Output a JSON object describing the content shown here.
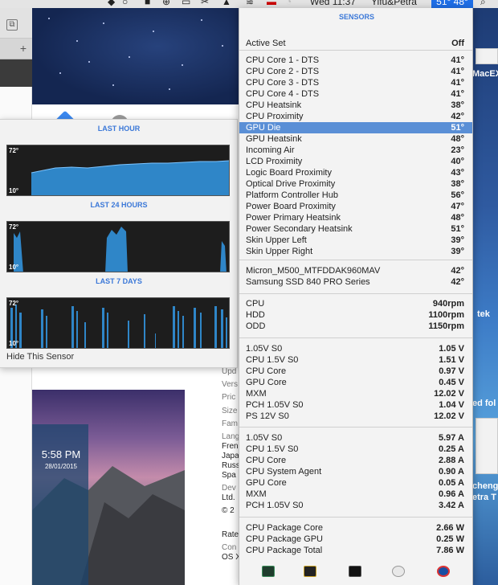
{
  "menubar": {
    "clock": "Wed 11:37",
    "user": "Yifu&Petra",
    "temp_badge": "51° 48°"
  },
  "desktop": {
    "label_top": "MacEX",
    "label_tek": "tek",
    "label_fol": "ed fol",
    "label_cheng": "cheng",
    "label_etra": "etra T"
  },
  "history": {
    "sections": [
      {
        "title": "LAST HOUR",
        "max": "72°",
        "min": "10°"
      },
      {
        "title": "LAST 24 HOURS",
        "max": "72°",
        "min": "10°"
      },
      {
        "title": "LAST 7 DAYS",
        "max": "72°",
        "min": "10°"
      }
    ],
    "hide_label": "Hide This Sensor"
  },
  "bgapp": {
    "labels": [
      "Upd",
      "Vers",
      "Pric",
      "Size",
      "Fam",
      "Lang",
      "Fren",
      "Japa",
      "Russ",
      "Spa",
      "Dev",
      "Ltd.",
      "© 2",
      "Rate",
      "Con",
      "OS X"
    ],
    "lock_time": "5:58 PM",
    "lock_date": "28/01/2015"
  },
  "sensors_menu": {
    "title": "SENSORS",
    "groups": [
      [
        {
          "name": "Active Set",
          "value": "Off"
        }
      ],
      [
        {
          "name": "CPU Core 1 - DTS",
          "value": "41°"
        },
        {
          "name": "CPU Core 2 - DTS",
          "value": "41°"
        },
        {
          "name": "CPU Core 3 - DTS",
          "value": "41°"
        },
        {
          "name": "CPU Core 4 - DTS",
          "value": "41°"
        },
        {
          "name": "CPU Heatsink",
          "value": "38°"
        },
        {
          "name": "CPU Proximity",
          "value": "42°"
        },
        {
          "name": "GPU Die",
          "value": "51°",
          "selected": true
        },
        {
          "name": "GPU Heatsink",
          "value": "48°"
        },
        {
          "name": "Incoming Air",
          "value": "23°"
        },
        {
          "name": "LCD Proximity",
          "value": "40°"
        },
        {
          "name": "Logic Board Proximity",
          "value": "43°"
        },
        {
          "name": "Optical Drive Proximity",
          "value": "38°"
        },
        {
          "name": "Platform Controller Hub",
          "value": "56°"
        },
        {
          "name": "Power Board Proximity",
          "value": "47°"
        },
        {
          "name": "Power Primary Heatsink",
          "value": "48°"
        },
        {
          "name": "Power Secondary Heatsink",
          "value": "51°"
        },
        {
          "name": "Skin Upper Left",
          "value": "39°"
        },
        {
          "name": "Skin Upper Right",
          "value": "39°"
        }
      ],
      [
        {
          "name": "Micron_M500_MTFDDAK960MAV",
          "value": "42°"
        },
        {
          "name": "Samsung SSD 840 PRO Series",
          "value": "42°"
        }
      ],
      [
        {
          "name": "CPU",
          "value": "940rpm"
        },
        {
          "name": "HDD",
          "value": "1100rpm"
        },
        {
          "name": "ODD",
          "value": "1150rpm"
        }
      ],
      [
        {
          "name": "1.05V S0",
          "value": "1.05 V"
        },
        {
          "name": "CPU 1.5V S0",
          "value": "1.51 V"
        },
        {
          "name": "CPU Core",
          "value": "0.97 V"
        },
        {
          "name": "GPU Core",
          "value": "0.45 V"
        },
        {
          "name": "MXM",
          "value": "12.02 V"
        },
        {
          "name": "PCH 1.05V S0",
          "value": "1.04 V"
        },
        {
          "name": "PS 12V S0",
          "value": "12.02 V"
        }
      ],
      [
        {
          "name": "1.05V S0",
          "value": "5.97 A"
        },
        {
          "name": "CPU 1.5V S0",
          "value": "0.25 A"
        },
        {
          "name": "CPU Core",
          "value": "2.88 A"
        },
        {
          "name": "CPU System Agent",
          "value": "0.90 A"
        },
        {
          "name": "GPU Core",
          "value": "0.05 A"
        },
        {
          "name": "MXM",
          "value": "0.96 A"
        },
        {
          "name": "PCH 1.05V S0",
          "value": "3.42 A"
        }
      ],
      [
        {
          "name": "CPU Package Core",
          "value": "2.66 W"
        },
        {
          "name": "CPU Package GPU",
          "value": "0.25 W"
        },
        {
          "name": "CPU Package Total",
          "value": "7.86 W"
        }
      ]
    ],
    "toolbar_icons": [
      "activity-monitor-icon",
      "istat-icon",
      "terminal-icon",
      "coffee-icon",
      "network-icon"
    ]
  }
}
